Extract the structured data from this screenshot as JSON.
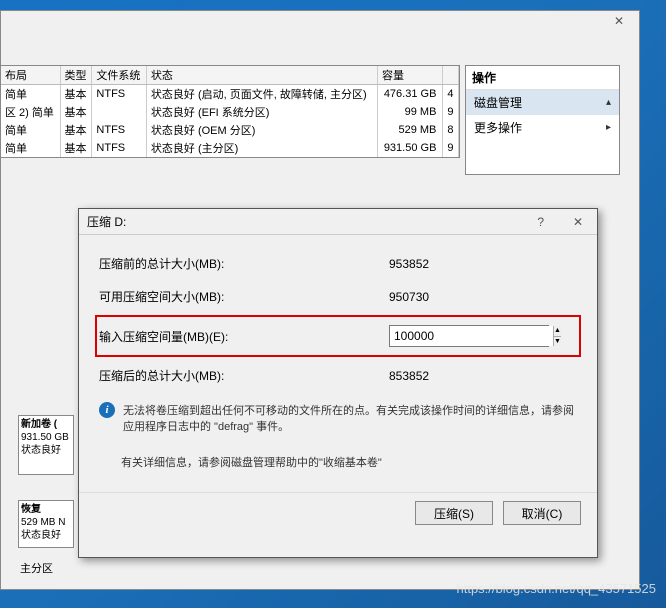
{
  "bg_window": {
    "close_glyph": "✕"
  },
  "table": {
    "headers": [
      "布局",
      "类型",
      "文件系统",
      "状态",
      "容量"
    ],
    "rows": [
      {
        "layout": "简单",
        "type": "基本",
        "fs": "NTFS",
        "status": "状态良好 (启动, 页面文件, 故障转储, 主分区)",
        "size": "476.31 GB",
        "x": "4"
      },
      {
        "layout": "简单",
        "type": "基本",
        "fs": "",
        "status": "状态良好 (EFI 系统分区)",
        "size": "99 MB",
        "x": "9"
      },
      {
        "layout": "简单",
        "type": "基本",
        "fs": "NTFS",
        "status": "状态良好 (OEM 分区)",
        "size": "529 MB",
        "x": "8"
      },
      {
        "layout": "简单",
        "type": "基本",
        "fs": "NTFS",
        "status": "状态良好 (主分区)",
        "size": "931.50 GB",
        "x": "9"
      }
    ],
    "row_prefix": "区 2)"
  },
  "actions": {
    "title": "操作",
    "items": [
      {
        "label": "磁盘管理",
        "expand": "▴",
        "selected": true
      },
      {
        "label": "更多操作",
        "expand": "▸",
        "selected": false
      }
    ]
  },
  "disk_boxes": [
    {
      "line1": "新加卷 (",
      "line2": "931.50 GB",
      "line3": "状态良好"
    },
    {
      "line1": "恢复",
      "line2": "529 MB N",
      "line3": "状态良好"
    }
  ],
  "footer": "主分区",
  "dialog": {
    "title": "压缩 D:",
    "help_glyph": "?",
    "close_glyph": "✕",
    "rows": [
      {
        "label": "压缩前的总计大小(MB):",
        "value": "953852"
      },
      {
        "label": "可用压缩空间大小(MB):",
        "value": "950730"
      },
      {
        "label": "输入压缩空间量(MB)(E):",
        "value": "100000",
        "input": true
      },
      {
        "label": "压缩后的总计大小(MB):",
        "value": "853852"
      }
    ],
    "info1": "无法将卷压缩到超出任何不可移动的文件所在的点。有关完成该操作时间的详细信息，请参阅应用程序日志中的 \"defrag\" 事件。",
    "info2": "有关详细信息，请参阅磁盘管理帮助中的\"收缩基本卷\"",
    "buttons": {
      "ok": "压缩(S)",
      "cancel": "取消(C)"
    }
  },
  "watermark": "https://blog.csdn.net/qq_43571525"
}
